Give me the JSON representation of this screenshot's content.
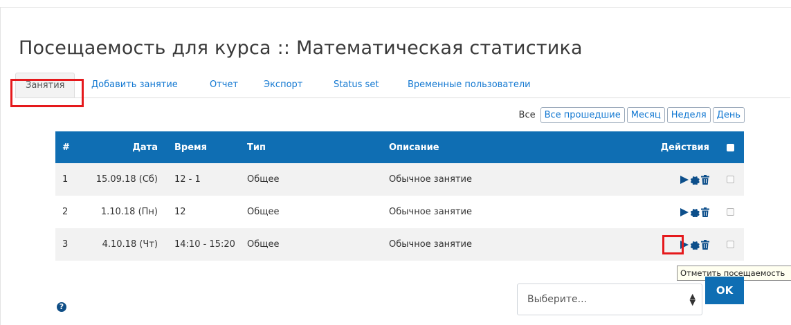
{
  "page": {
    "title": "Посещаемость для курса :: Математическая статистика"
  },
  "tabs": [
    {
      "label": "Занятия",
      "active": true
    },
    {
      "label": "Добавить занятие"
    },
    {
      "label": "Отчет"
    },
    {
      "label": "Экспорт"
    },
    {
      "label": "Status set"
    },
    {
      "label": "Временные пользователи"
    }
  ],
  "filters": {
    "all_label": "Все",
    "buttons": [
      "Все прошедшие",
      "Месяц",
      "Неделя",
      "День"
    ]
  },
  "table": {
    "headers": {
      "num": "#",
      "date": "Дата",
      "time": "Время",
      "type": "Тип",
      "description": "Описание",
      "actions": "Действия"
    },
    "rows": [
      {
        "num": "1",
        "date": "15.09.18 (Сб)",
        "time": "12 - 1",
        "type": "Общее",
        "description": "Обычное занятие"
      },
      {
        "num": "2",
        "date": "1.10.18 (Пн)",
        "time": "12",
        "type": "Общее",
        "description": "Обычное занятие"
      },
      {
        "num": "3",
        "date": "4.10.18 (Чт)",
        "time": "14:10 - 15:20",
        "type": "Общее",
        "description": "Обычное занятие"
      }
    ],
    "action_icons": [
      "play-icon",
      "gear-icon",
      "trash-icon"
    ]
  },
  "tooltip": {
    "text": "Отметить посещаемость"
  },
  "bulk": {
    "select_placeholder": "Выберите...",
    "ok_label": "OK"
  },
  "colors": {
    "header_bg": "#0f6eb3",
    "link": "#1177d1",
    "highlight": "#e5191c"
  }
}
